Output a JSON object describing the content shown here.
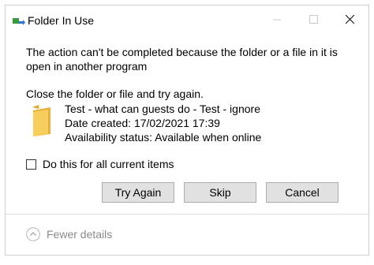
{
  "window": {
    "title": "Folder In Use",
    "app_icon": "folder-move-icon"
  },
  "titlebar_buttons": {
    "minimize_icon": "minimize-icon",
    "maximize_icon": "maximize-icon",
    "close_icon": "close-icon"
  },
  "dialog": {
    "message": "The action can't be completed because the folder or a file in it is open in another program",
    "instruction": "Close the folder or file and try again.",
    "item": {
      "icon": "folder-icon",
      "name": "Test - what can guests do - Test - ignore",
      "date_created": "Date created: 17/02/2021 17:39",
      "availability": "Availability status: Available when online"
    },
    "checkbox": {
      "label": "Do this for all current items",
      "checked": false
    },
    "buttons": {
      "try_again": "Try Again",
      "skip": "Skip",
      "cancel": "Cancel"
    }
  },
  "footer": {
    "fewer_details": "Fewer details",
    "icon": "chevron-up-icon"
  },
  "colors": {
    "folder": "#f5c64b",
    "button_bg": "#e1e1e1",
    "muted_text": "#8a8a8a"
  }
}
